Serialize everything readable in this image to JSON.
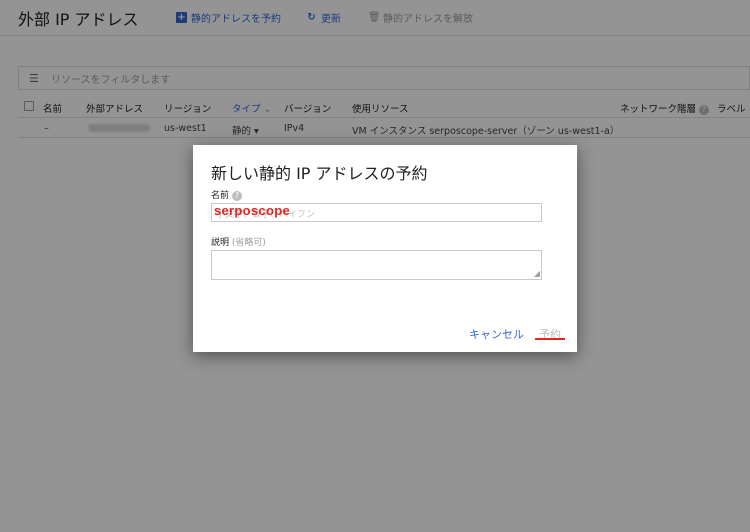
{
  "header": {
    "title": "外部 IP アドレス",
    "reserve_label": "静的アドレスを予約",
    "refresh_label": "更新",
    "release_label": "静的アドレスを解放"
  },
  "filter": {
    "placeholder": "リソースをフィルタします"
  },
  "table": {
    "columns": [
      "名前",
      "外部アドレス",
      "リージョン",
      "タイプ",
      "バージョン",
      "使用リソース",
      "ネットワーク階層",
      "ラベル"
    ],
    "rows": [
      {
        "name": "–",
        "region": "us-west1",
        "type": "静的",
        "version": "IPv4",
        "in_use_by": "VM インスタンス serposcope-server（ゾーン us-west1-a）"
      }
    ]
  },
  "dialog": {
    "title": "新しい静的 IP アドレスの予約",
    "name_label": "名前",
    "name_placeholder": "小文字、数字、ハイフン",
    "name_value": "serposcope",
    "description_label": "説明",
    "description_optional": "(省略可)",
    "cancel_label": "キャンセル",
    "reserve_label": "予約"
  },
  "colors": {
    "accent": "#3367d6",
    "annotation": "#e8231f"
  }
}
